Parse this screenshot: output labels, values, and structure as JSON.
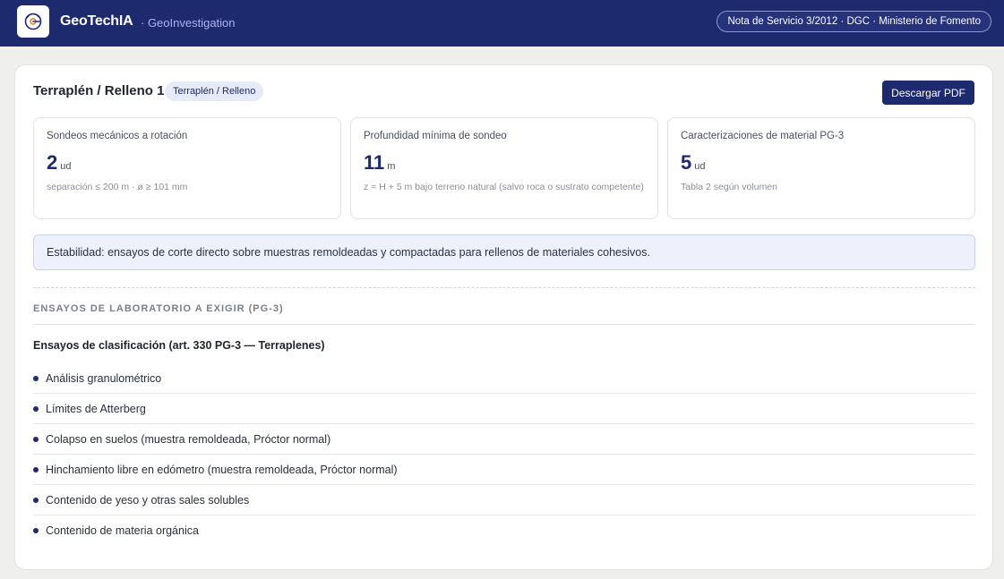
{
  "header": {
    "brand": "GeoTechIA",
    "subtitle": "· GeoInvestigation",
    "norm": "Nota de Servicio 3/2012 · DGC · Ministerio de Fomento"
  },
  "card": {
    "title": "Terraplén / Relleno 1",
    "tag": "Terraplén / Relleno",
    "download_label": "Descargar PDF"
  },
  "stats": [
    {
      "label": "Sondeos mecánicos a rotación",
      "value": "2",
      "unit": "ud",
      "note": "separación ≤ 200 m · ø ≥ 101 mm"
    },
    {
      "label": "Profundidad mínima de sondeo",
      "value": "11",
      "unit": "m",
      "note": "z = H + 5 m bajo terreno natural (salvo roca o sustrato competente)"
    },
    {
      "label": "Caracterizaciones de material PG-3",
      "value": "5",
      "unit": "ud",
      "note": "Tabla 2 según volumen"
    }
  ],
  "alert": "Estabilidad: ensayos de corte directo sobre muestras remoldeadas y compactadas para rellenos de materiales cohesivos.",
  "lab": {
    "heading": "ENSAYOS DE LABORATORIO A EXIGIR (PG-3)",
    "group_title": "Ensayos de clasificación (art. 330 PG-3 — Terraplenes)",
    "tests": [
      "Análisis granulométrico",
      "Límites de Atterberg",
      "Colapso en suelos (muestra remoldeada, Próctor normal)",
      "Hinchamiento libre en edómetro (muestra remoldeada, Próctor normal)",
      "Contenido de yeso y otras sales solubles",
      "Contenido de materia orgánica"
    ]
  },
  "colors": {
    "primary": "#1e2a6e",
    "alert_bg": "#eef1fc"
  },
  "icons": {
    "logo": "gear-logo-icon",
    "bullet": "bullet-dot-icon"
  }
}
